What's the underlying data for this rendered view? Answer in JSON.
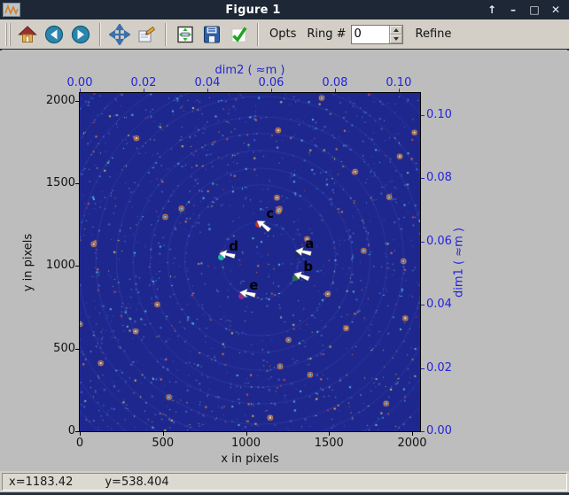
{
  "window": {
    "title": "Figure 1",
    "app_icon": "matplotlib-logo",
    "controls": [
      {
        "name": "shade",
        "glyph": "↑"
      },
      {
        "name": "minimize",
        "glyph": "–"
      },
      {
        "name": "maximize",
        "glyph": "□"
      },
      {
        "name": "close",
        "glyph": "✕"
      }
    ]
  },
  "toolbar": {
    "buttons": [
      "home",
      "back",
      "forward",
      "pan",
      "edit",
      "configure-subplots",
      "save",
      "apply-check"
    ],
    "opts_label": "Opts",
    "ring_label": "Ring #",
    "ring_value": "0",
    "refine_label": "Refine"
  },
  "statusbar": {
    "x_value": "x=1183.42",
    "y_value": "y=538.404"
  },
  "chart_data": {
    "type": "scatter",
    "description": "Powder diffraction image with picked calibration peaks",
    "xlabel": "x in pixels",
    "ylabel": "y in pixels",
    "top_axis_label": "dim2 ( ≈m )",
    "right_axis_label": "dim1 ( ≈m )",
    "xlim": [
      0,
      2048
    ],
    "ylim": [
      0,
      2048
    ],
    "top_axis_max": 0.1067,
    "right_axis_max": 0.1069,
    "x_ticks": [
      {
        "v": 0,
        "l": "0"
      },
      {
        "v": 500,
        "l": "500"
      },
      {
        "v": 1000,
        "l": "1000"
      },
      {
        "v": 1500,
        "l": "1500"
      },
      {
        "v": 2000,
        "l": "2000"
      }
    ],
    "y_ticks": [
      {
        "v": 0,
        "l": "0"
      },
      {
        "v": 500,
        "l": "500"
      },
      {
        "v": 1000,
        "l": "1000"
      },
      {
        "v": 1500,
        "l": "1500"
      },
      {
        "v": 2000,
        "l": "2000"
      }
    ],
    "top_ticks": [
      {
        "v": 0.0,
        "l": "0.00"
      },
      {
        "v": 0.02,
        "l": "0.02"
      },
      {
        "v": 0.04,
        "l": "0.04"
      },
      {
        "v": 0.06,
        "l": "0.06"
      },
      {
        "v": 0.08,
        "l": "0.08"
      },
      {
        "v": 0.1,
        "l": "0.10"
      }
    ],
    "right_ticks": [
      {
        "v": 0.0,
        "l": "0.00"
      },
      {
        "v": 0.02,
        "l": "0.02"
      },
      {
        "v": 0.04,
        "l": "0.04"
      },
      {
        "v": 0.06,
        "l": "0.06"
      },
      {
        "v": 0.08,
        "l": "0.08"
      },
      {
        "v": 0.1,
        "l": "0.10"
      }
    ],
    "axis_accent_color": "#2424dd",
    "background_color": "#1e278e",
    "beam_center": {
      "x": 1085,
      "y": 1035
    },
    "ring_radii_data_units": [
      230,
      454,
      555,
      662,
      764,
      865,
      988,
      1095,
      1201,
      1308,
      1415,
      1520,
      1630,
      1740
    ],
    "points": [
      {
        "label": "a",
        "x": 1308,
        "y": 1071,
        "color": "#1d2a66",
        "arrow_angle": 14
      },
      {
        "label": "b",
        "x": 1298,
        "y": 932,
        "color": "#227a33",
        "arrow_angle": 22
      },
      {
        "label": "c",
        "x": 1073,
        "y": 1253,
        "color": "#cf2b20",
        "arrow_angle": 40
      },
      {
        "label": "d",
        "x": 849,
        "y": 1055,
        "color": "#18b7aa",
        "arrow_angle": 14
      },
      {
        "label": "e",
        "x": 972,
        "y": 820,
        "color": "#8f2d8f",
        "arrow_angle": 14
      }
    ]
  }
}
